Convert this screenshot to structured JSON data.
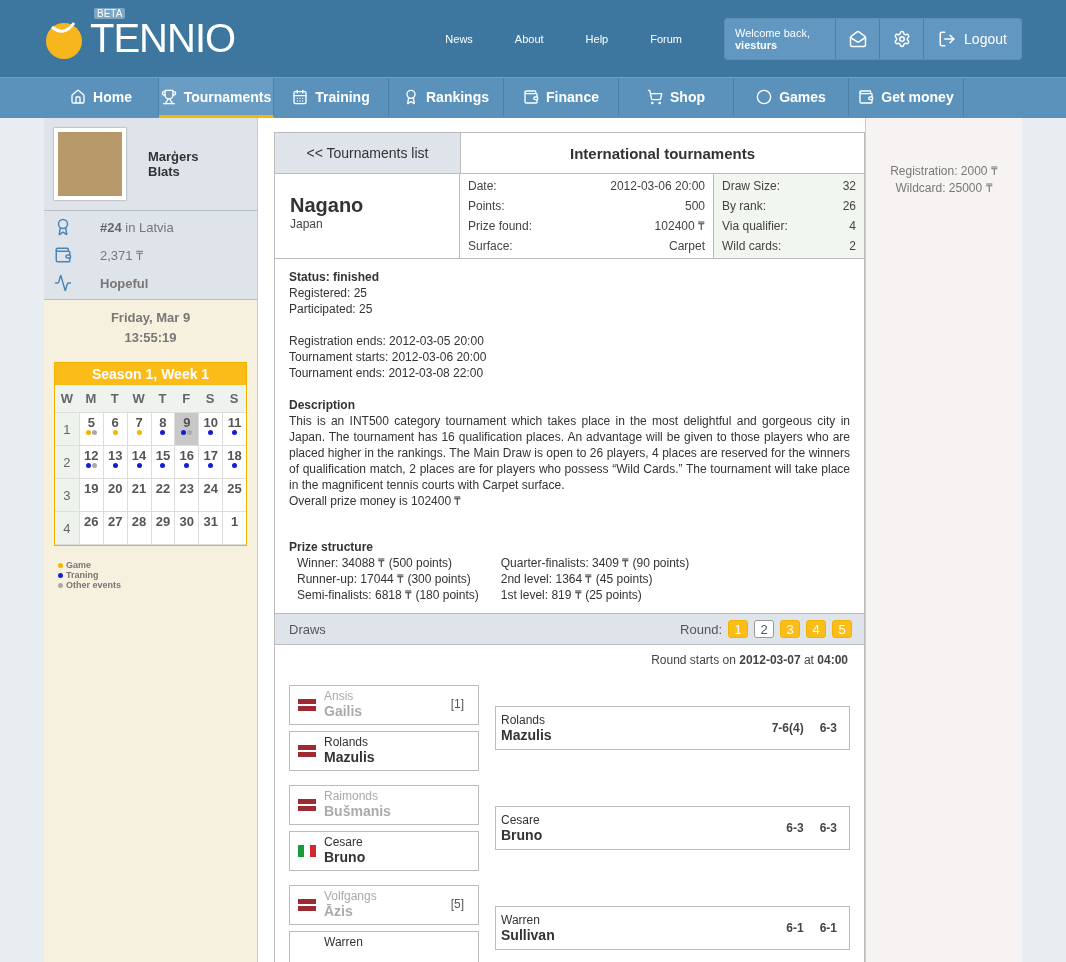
{
  "header": {
    "logo_badge": "BETA",
    "logo_text": "TENNIO",
    "links": [
      "News",
      "About",
      "Help",
      "Forum"
    ],
    "welcome": "Welcome back,",
    "username": "viesturs",
    "logout": "Logout"
  },
  "nav": [
    {
      "label": "Home",
      "selected": false
    },
    {
      "label": "Tournaments",
      "selected": true
    },
    {
      "label": "Training",
      "selected": false
    },
    {
      "label": "Rankings",
      "selected": false
    },
    {
      "label": "Finance",
      "selected": false
    },
    {
      "label": "Shop",
      "selected": false
    },
    {
      "label": "Games",
      "selected": false
    },
    {
      "label": "Get money",
      "selected": false
    }
  ],
  "profile": {
    "first_name": "Marģers",
    "last_name": "Blats",
    "stats": [
      {
        "kind": "rank",
        "text": "**#24** in Latvia"
      },
      {
        "kind": "money",
        "text": "2,371 ₸"
      },
      {
        "kind": "status",
        "text": "Hopeful"
      }
    ],
    "date": "Friday, Mar 9",
    "time": "13:55:19"
  },
  "calendar": {
    "title": "Season 1, Week 1",
    "headers": [
      "W",
      "M",
      "T",
      "W",
      "T",
      "F",
      "S",
      "S"
    ],
    "weeks": [
      {
        "week": "1",
        "days": [
          {
            "day": "5",
            "selected": false,
            "dots": [
              {
                "color": "#f5b400"
              },
              {
                "color": "#aaaaaa"
              }
            ]
          },
          {
            "day": "6",
            "selected": false,
            "dots": [
              {
                "color": "#f5b400"
              }
            ]
          },
          {
            "day": "7",
            "selected": false,
            "dots": [
              {
                "color": "#f5b400"
              }
            ]
          },
          {
            "day": "8",
            "selected": false,
            "dots": [
              {
                "color": "#1020d0"
              }
            ]
          },
          {
            "day": "9",
            "selected": true,
            "dots": [
              {
                "color": "#1020d0"
              },
              {
                "color": "#aaaaaa"
              }
            ]
          },
          {
            "day": "10",
            "selected": false,
            "dots": [
              {
                "color": "#1020d0"
              }
            ]
          },
          {
            "day": "11",
            "selected": false,
            "dots": [
              {
                "color": "#1020d0"
              }
            ]
          }
        ]
      },
      {
        "week": "2",
        "days": [
          {
            "day": "12",
            "selected": false,
            "dots": [
              {
                "color": "#1020d0"
              },
              {
                "color": "#aaaaaa"
              }
            ]
          },
          {
            "day": "13",
            "selected": false,
            "dots": [
              {
                "color": "#1020d0"
              }
            ]
          },
          {
            "day": "14",
            "selected": false,
            "dots": [
              {
                "color": "#1020d0"
              }
            ]
          },
          {
            "day": "15",
            "selected": false,
            "dots": [
              {
                "color": "#1020d0"
              }
            ]
          },
          {
            "day": "16",
            "selected": false,
            "dots": [
              {
                "color": "#1020d0"
              }
            ]
          },
          {
            "day": "17",
            "selected": false,
            "dots": [
              {
                "color": "#1020d0"
              }
            ]
          },
          {
            "day": "18",
            "selected": false,
            "dots": [
              {
                "color": "#1020d0"
              }
            ]
          }
        ]
      },
      {
        "week": "3",
        "days": [
          {
            "day": "19",
            "selected": false
          },
          {
            "day": "20",
            "selected": false
          },
          {
            "day": "21",
            "selected": false
          },
          {
            "day": "22",
            "selected": false
          },
          {
            "day": "23",
            "selected": false
          },
          {
            "day": "24",
            "selected": false
          },
          {
            "day": "25",
            "selected": false
          }
        ]
      },
      {
        "week": "4",
        "days": [
          {
            "day": "26",
            "selected": false
          },
          {
            "day": "27",
            "selected": false
          },
          {
            "day": "28",
            "selected": false
          },
          {
            "day": "29",
            "selected": false
          },
          {
            "day": "30",
            "selected": false
          },
          {
            "day": "31",
            "selected": false
          },
          {
            "day": "1",
            "selected": false
          }
        ]
      }
    ],
    "legend": [
      {
        "label": "Game",
        "color": "#f5b400"
      },
      {
        "label": "Traning",
        "color": "#1020d0"
      },
      {
        "label": "Other events",
        "color": "#aaaaaa"
      }
    ]
  },
  "tournament": {
    "back": "<< Tournaments list",
    "heading": "International tournaments",
    "city": "Nagano",
    "country": "Japan",
    "info": [
      {
        "label": "Date:",
        "value": "2012-03-06 20:00"
      },
      {
        "label": "Points:",
        "value": "500"
      },
      {
        "label": "Prize found:",
        "value": "102400 ₸"
      },
      {
        "label": "Surface:",
        "value": "Carpet"
      }
    ],
    "draw_info": [
      {
        "label": "Draw Size:",
        "value": "32"
      },
      {
        "label": "By rank:",
        "value": "26"
      },
      {
        "label": "Via qualifier:",
        "value": "4"
      },
      {
        "label": "Wild cards:",
        "value": "2"
      }
    ],
    "status": "Status: finished",
    "counts": [
      "Registered: 25",
      "Participated: 25"
    ],
    "dates": [
      "Registration ends: 2012-03-05 20:00",
      "Tournament starts: 2012-03-06 20:00",
      "Tournament ends: 2012-03-08 22:00"
    ],
    "description_title": "Description",
    "description": "This is an INT500 category tournament which takes place in the most delightful and gorgeous city in Japan. The tournament has 16 qualification places. An advantage will be given to those players who are placed higher in the rankings. The Main Draw is open to 26 players, 4 places are reserved for the winners of qualification match, 2 places are for players who possess “Wild Cards.” The tournament will take place in the magnificent tennis courts with Carpet surface.",
    "prize_money": "Overall prize money is 102400 ₸",
    "prize_title": "Prize structure",
    "prizes": [
      [
        "Winner: 34088 ₸ (500 points)",
        "Runner-up: 17044 ₸ (300 points)",
        "Semi-finalists: 6818 ₸ (180 points)"
      ],
      [
        "Quarter-finalists: 3409 ₸ (90 points)",
        "2nd level: 1364 ₸ (45 points)",
        "1st level: 819 ₸ (25 points)"
      ]
    ]
  },
  "draws": {
    "title": "Draws",
    "round_label": "Round:",
    "rounds": [
      {
        "label": "1",
        "selected": false
      },
      {
        "label": "2",
        "selected": true
      },
      {
        "label": "3",
        "selected": false
      },
      {
        "label": "4",
        "selected": false
      },
      {
        "label": "5",
        "selected": false
      }
    ],
    "round_start": "Round starts on **2012-03-07** at **04:00**",
    "matches": [
      {
        "players": [
          {
            "kind": "latvia",
            "first": "Ansis",
            "last": "Gailis",
            "seed": "[1]",
            "lost": true
          },
          {
            "kind": "latvia",
            "first": "Rolands",
            "last": "Mazulis",
            "lost": false
          }
        ],
        "winner": {
          "first": "Rolands",
          "last": "Mazulis",
          "scores": [
            "7-6(4)",
            "6-3"
          ]
        }
      },
      {
        "players": [
          {
            "kind": "latvia",
            "first": "Raimonds",
            "last": "Bušmanis",
            "lost": true
          },
          {
            "kind": "italy",
            "first": "Cesare",
            "last": "Bruno",
            "lost": false
          }
        ],
        "winner": {
          "first": "Cesare",
          "last": "Bruno",
          "scores": [
            "6-3",
            "6-3"
          ]
        }
      },
      {
        "players": [
          {
            "kind": "latvia",
            "first": "Volfgangs",
            "last": "Āzis",
            "seed": "[5]",
            "lost": true
          },
          {
            "first": "Warren"
          }
        ],
        "winner": {
          "first": "Warren",
          "last": "Sullivan",
          "scores": [
            "6-1",
            "6-1"
          ]
        }
      }
    ]
  },
  "fees": [
    "Registration: 2000 ₸",
    "Wildcard: 25000 ₸"
  ]
}
